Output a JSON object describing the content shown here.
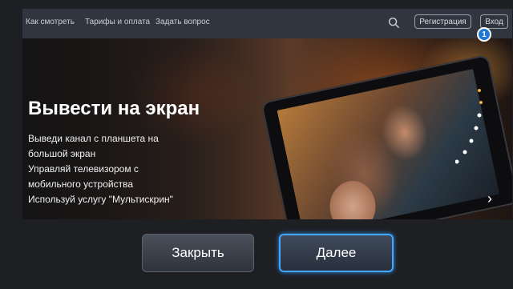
{
  "topbar": {
    "links": [
      "Как смотреть",
      "Тарифы и оплата",
      "Задать вопрос"
    ],
    "register_label": "Регистрация",
    "login_label": "Вход",
    "badge": "1"
  },
  "hero": {
    "title": "Вывести на экран",
    "lines": [
      "Выведи канал с планшета на",
      "большой экран",
      "Управляй телевизором с",
      "мобильного устройства",
      "Используй услугу \"Мультискрин\""
    ],
    "next_arrow": "›"
  },
  "dialog": {
    "close_label": "Закрыть",
    "next_label": "Далее"
  },
  "colors": {
    "accent": "#43a7ff",
    "badge": "#1d78d6",
    "topbar": "#30353f"
  }
}
